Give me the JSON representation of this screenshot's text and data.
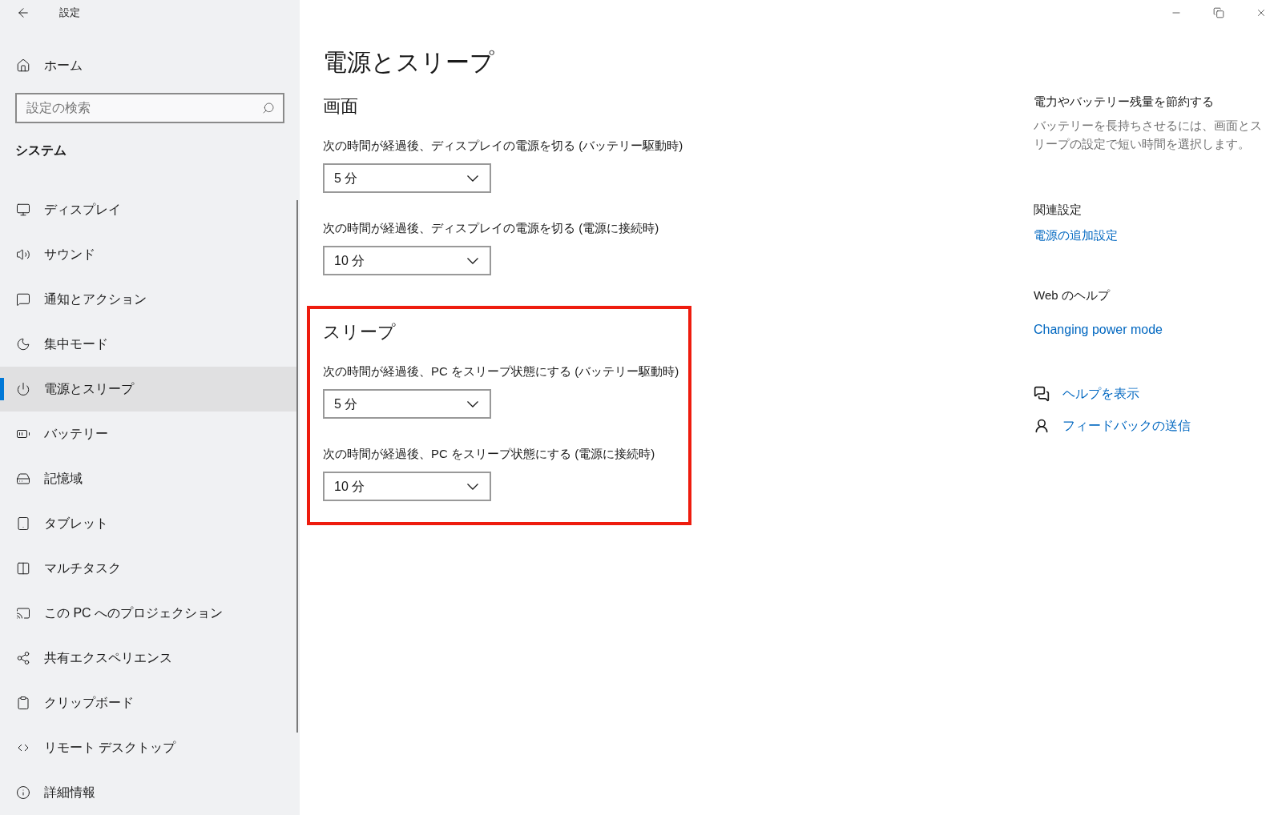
{
  "window": {
    "title": "設定"
  },
  "sidebar": {
    "home": "ホーム",
    "search": {
      "placeholder": "設定の検索"
    },
    "section": "システム",
    "items": [
      {
        "label": "ディスプレイ",
        "selected": false
      },
      {
        "label": "サウンド",
        "selected": false
      },
      {
        "label": "通知とアクション",
        "selected": false
      },
      {
        "label": "集中モード",
        "selected": false
      },
      {
        "label": "電源とスリープ",
        "selected": true
      },
      {
        "label": "バッテリー",
        "selected": false
      },
      {
        "label": "記憶域",
        "selected": false
      },
      {
        "label": "タブレット",
        "selected": false
      },
      {
        "label": "マルチタスク",
        "selected": false
      },
      {
        "label": "この PC へのプロジェクション",
        "selected": false
      },
      {
        "label": "共有エクスペリエンス",
        "selected": false
      },
      {
        "label": "クリップボード",
        "selected": false
      },
      {
        "label": "リモート デスクトップ",
        "selected": false
      },
      {
        "label": "詳細情報",
        "selected": false
      }
    ]
  },
  "page_title": "電源とスリープ",
  "sections": [
    {
      "heading": "画面",
      "highlighted": false,
      "settings": [
        {
          "label": "次の時間が経過後、ディスプレイの電源を切る (バッテリー駆動時)",
          "value": "5 分"
        },
        {
          "label": "次の時間が経過後、ディスプレイの電源を切る (電源に接続時)",
          "value": "10 分"
        }
      ]
    },
    {
      "heading": "スリープ",
      "highlighted": true,
      "settings": [
        {
          "label": "次の時間が経過後、PC をスリープ状態にする (バッテリー駆動時)",
          "value": "5 分"
        },
        {
          "label": "次の時間が経過後、PC をスリープ状態にする (電源に接続時)",
          "value": "10 分"
        }
      ]
    }
  ],
  "aside": {
    "tip_heading": "電力やバッテリー残量を節約する",
    "tip_text": "バッテリーを長持ちさせるには、画面とスリープの設定で短い時間を選択します。",
    "related_heading": "関連設定",
    "related_link": "電源の追加設定",
    "web_heading": "Web のヘルプ",
    "web_link": "Changing power mode",
    "help_links": [
      "ヘルプを表示",
      "フィードバックの送信"
    ]
  }
}
